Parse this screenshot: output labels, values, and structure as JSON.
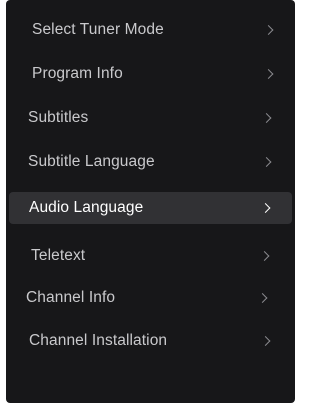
{
  "menu": {
    "items": [
      {
        "label": "Select Tuner  Mode",
        "arrow": ">"
      },
      {
        "label": "Program Info",
        "arrow": ">"
      },
      {
        "label": "Subtitles",
        "arrow": ">"
      },
      {
        "label": "Subtitle Language",
        "arrow": ">"
      },
      {
        "label": "Audio Language",
        "arrow": ">",
        "selected": true
      },
      {
        "label": "Teletext",
        "arrow": ">"
      },
      {
        "label": "Channel Info",
        "arrow": ">"
      },
      {
        "label": "Channel  Installation",
        "arrow": ">"
      }
    ]
  },
  "colors": {
    "panel_bg": "#171719",
    "selected_bg": "#313134",
    "text": "#c9c9cc",
    "selected_text": "#ffffff"
  }
}
